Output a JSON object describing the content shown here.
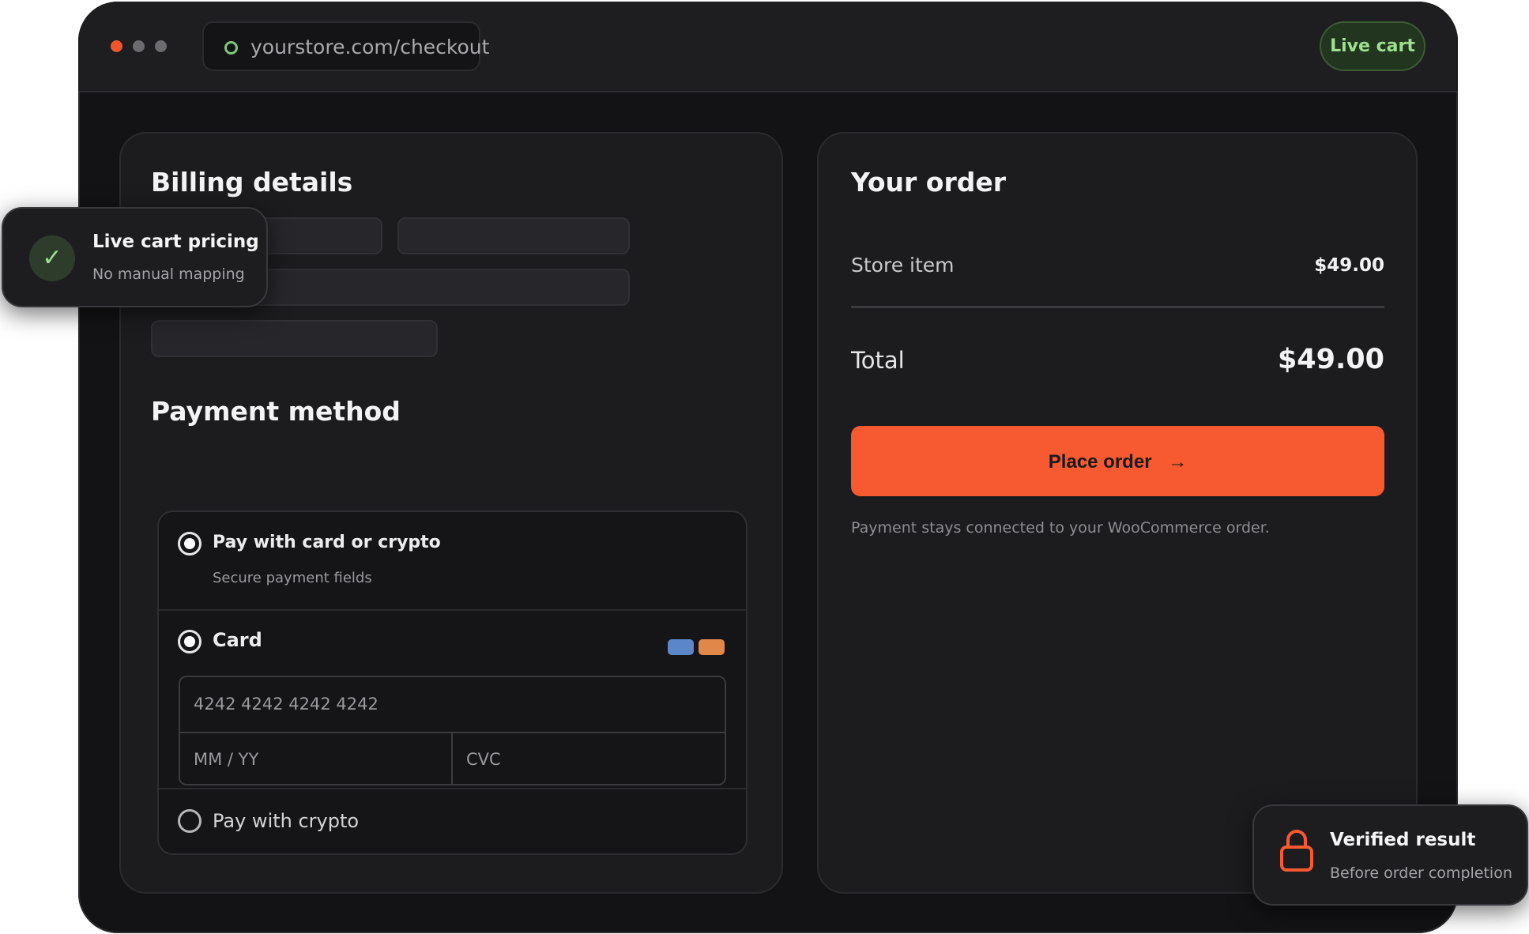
{
  "browser": {
    "url": "yourstore.com/checkout",
    "badge": "Live cart"
  },
  "billing": {
    "title": "Billing details"
  },
  "payment": {
    "title": "Payment method",
    "options": [
      {
        "label": "Pay with card or crypto",
        "sub": "Secure payment fields",
        "selected": true
      },
      {
        "label": "Card",
        "selected": true
      },
      {
        "label": "Pay with crypto",
        "selected": false
      }
    ],
    "card_number_placeholder": "4242 4242 4242 4242",
    "expiry_placeholder": "MM / YY",
    "cvc_placeholder": "CVC",
    "card_brand_colors": [
      "#5b86c7",
      "#e0874a"
    ]
  },
  "order": {
    "title": "Your order",
    "item_label": "Store item",
    "item_price": "$49.00",
    "total_label": "Total",
    "total_value": "$49.00",
    "place_order_label": "Place order",
    "place_order_arrow": "→",
    "note": "Payment stays connected to your WooCommerce order."
  },
  "toasts": {
    "live_pricing": {
      "icon": "check-icon",
      "glyph": "✓",
      "title": "Live cart pricing",
      "sub": "No manual mapping"
    },
    "verified": {
      "icon": "lock-icon",
      "title": "Verified result",
      "sub": "Before order completion"
    }
  },
  "colors": {
    "accent": "#f75a30",
    "live_green": "#9ee08f"
  }
}
